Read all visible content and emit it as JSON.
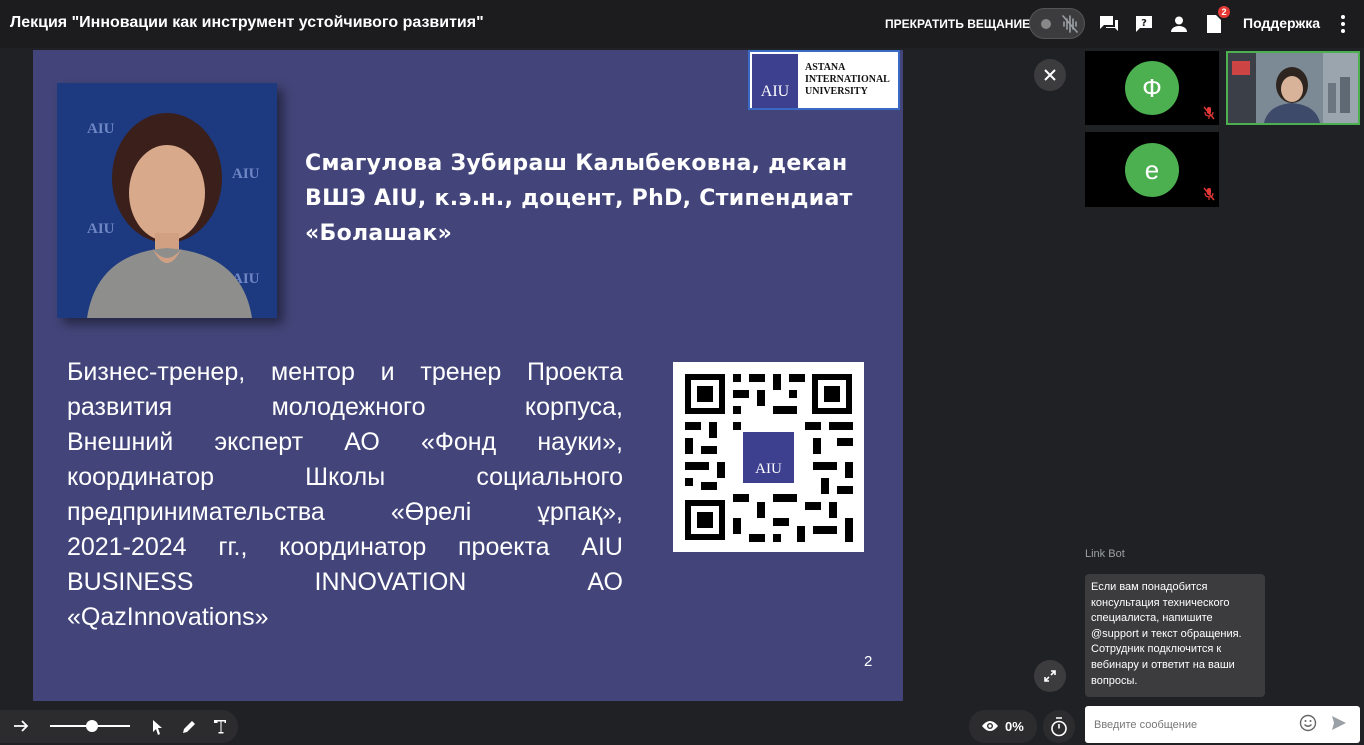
{
  "header": {
    "title": "Лекция \"Инновации как инструмент устойчивого развития\"",
    "stop_broadcast_label": "ПРЕКРАТИТЬ ВЕЩАНИЕ",
    "files_badge": "2",
    "support_label": "Поддержка"
  },
  "slide": {
    "logo_mark": "AIU",
    "logo_text_line1": "ASTANA",
    "logo_text_line2": "INTERNATIONAL",
    "logo_text_line3": "UNIVERSITY",
    "portrait_logo": "AIU",
    "name_line1": "Смагулова  Зубираш Калыбековна, декан",
    "name_line2": "ВШЭ AIU, к.э.н., доцент, PhD, Стипендиат",
    "name_line3": "«Болашак»",
    "bio_lines": [
      "Бизнес-тренер, ментор и тренер Проекта",
      "развития молодежного корпуса,",
      "Внешний эксперт АО «Фонд науки»,",
      "координатор Школы социального",
      "предпринимательства «Өрелі ұрпақ»,",
      "2021-2024 гг., координатор проекта AIU",
      "BUSINESS INNOVATION АО",
      "«QazInnovations»"
    ],
    "qr_label": "AIU",
    "page_number": "2"
  },
  "participants": [
    {
      "initial": "Ф",
      "muted": true
    },
    {
      "initial": "е",
      "muted": true
    }
  ],
  "chat": {
    "bot_name": "Link Bot",
    "bot_message": "Если вам понадобится консультация технического специалиста, напишите @support и текст обращения. Сотрудник подключится к вебинару и ответит на ваши вопросы.",
    "input_placeholder": "Введите сообщение"
  },
  "bottom": {
    "zoom_percent": "0%",
    "pen_slider_value": 0.55
  },
  "colors": {
    "slide_bg": "#43457a",
    "avatar_green": "#4caf50",
    "active_speaker_border": "#4caf50",
    "badge_red": "#e53935"
  }
}
